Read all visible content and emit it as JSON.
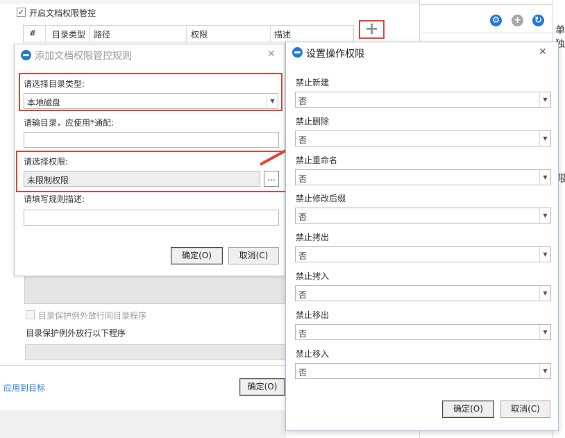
{
  "background": {
    "enable_checkbox_label": "开启文档权限管控",
    "table_headers": [
      "#",
      "目录类型",
      "路径",
      "权限",
      "描述"
    ],
    "exception_same_dir_label": "目录保护例外放行同目录程序",
    "exception_programs_label": "目录保护例外放行以下程序",
    "apply_link": "应用到目标",
    "ok_button": "确定(O)",
    "right_text_1": "单独",
    "right_text_2": "限"
  },
  "dialog1": {
    "title": "添加文档权限管控规则",
    "close": "✕",
    "dir_type_label": "请选择目录类型:",
    "dir_type_value": "本地磁盘",
    "dir_label": "请输目录，应使用*通配:",
    "dir_value": "",
    "perm_label": "请选择权限:",
    "perm_value": "未限制权限",
    "browse_button": "...",
    "desc_label": "请填写规则描述:",
    "desc_value": "",
    "ok": "确定(O)",
    "cancel": "取消(C)"
  },
  "dialog2": {
    "title": "设置操作权限",
    "close": "✕",
    "rows": [
      {
        "label": "禁止新建",
        "value": "否"
      },
      {
        "label": "禁止删除",
        "value": "否"
      },
      {
        "label": "禁止重命名",
        "value": "否"
      },
      {
        "label": "禁止修改后缀",
        "value": "否"
      },
      {
        "label": "禁止拷出",
        "value": "否"
      },
      {
        "label": "禁止拷入",
        "value": "否"
      },
      {
        "label": "禁止移出",
        "value": "否"
      },
      {
        "label": "禁止移入",
        "value": "否"
      }
    ],
    "ok": "确定(O)",
    "cancel": "取消(C)"
  },
  "colors": {
    "highlight": "#e2463a",
    "brand_blue": "#1f7ad8",
    "link": "#2a7ad6"
  },
  "icons": [
    "gear-icon",
    "plus-circle-icon",
    "refresh-icon",
    "add-icon",
    "checkmark-icon",
    "close-icon",
    "chevron-down-icon"
  ]
}
